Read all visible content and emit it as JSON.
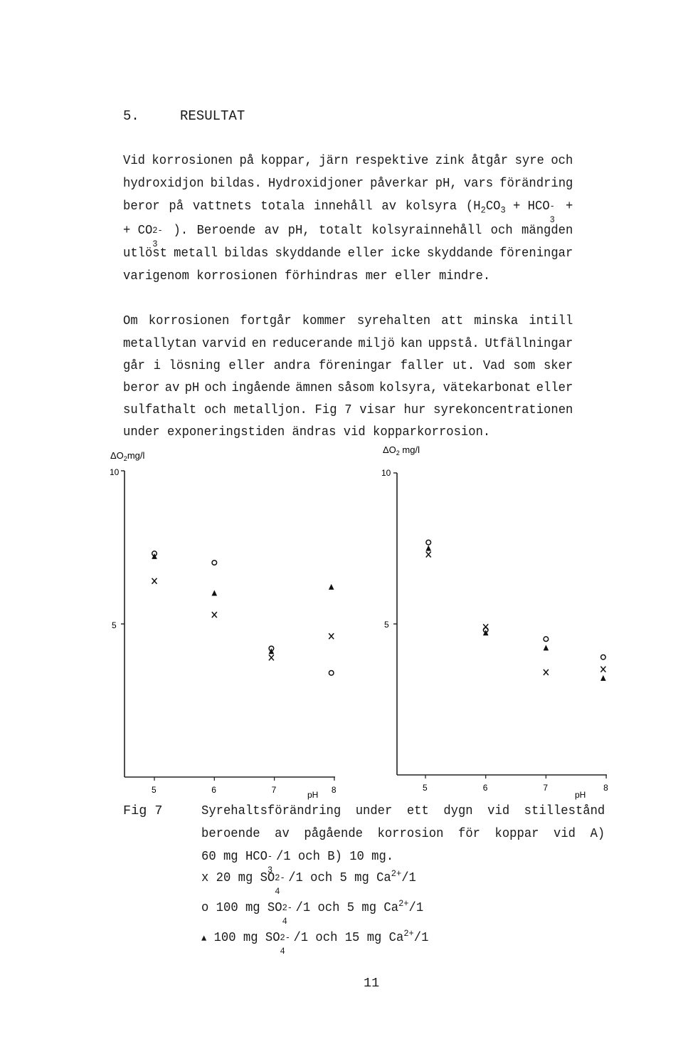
{
  "section": {
    "number": "5.",
    "title": "RESULTAT"
  },
  "paragraph1": {
    "line1": [
      "Vid",
      "korrosionen",
      "på",
      "koppar,",
      "järn",
      "respektive",
      "zink",
      "åtgår",
      "syre",
      "och"
    ],
    "line2": [
      "hydroxidjon",
      "bildas.",
      "Hydroxidjoner",
      "påverkar",
      "pH,",
      "vars",
      "förändring"
    ],
    "line3_words": [
      "beror",
      "på",
      "vattnets",
      "totala",
      "innehåll",
      "av",
      "kolsyra"
    ],
    "line3_formula": {
      "open": "(H",
      "sub1": "2",
      "mid": "CO",
      "sub2": "3",
      "plus": " + HCO",
      "sup3": "-",
      "sub3": "3",
      "end": " +"
    },
    "line4_formula": {
      "start": "+ CO",
      "sup": "2-",
      "sub": "3",
      "end": " )."
    },
    "line4_words": [
      "Beroende",
      "av",
      "pH,",
      "totalt",
      "kolsyrainnehåll",
      "och",
      "mängden"
    ],
    "line5": [
      "utlöst",
      "metall",
      "bildas",
      "skyddande",
      "eller",
      "icke",
      "skyddande",
      "föreningar"
    ],
    "line6": "varigenom korrosionen förhindras mer eller mindre."
  },
  "paragraph2": {
    "line1": [
      "Om",
      "korrosionen",
      "fortgår",
      "kommer",
      "syrehalten",
      "att",
      "minska",
      "intill"
    ],
    "line2": [
      "metallytan",
      "varvid",
      "en",
      "reducerande",
      "miljö",
      "kan",
      "uppstå.",
      "Utfällningar"
    ],
    "line3": [
      "går",
      "i",
      "lösning",
      "eller",
      "andra",
      "föreningar",
      "faller",
      "ut.",
      "Vad",
      "som",
      "sker"
    ],
    "line4": [
      "beror",
      "av",
      "pH",
      "och",
      "ingående",
      "ämnen",
      "såsom",
      "kolsyra,",
      "vätekarbonat",
      "eller"
    ],
    "line5": [
      "sulfathalt",
      "och",
      "metalljon.",
      "Fig",
      "7",
      "visar",
      "hur",
      "syrekoncentrationen"
    ],
    "line6": "under exponeringstiden ändras vid kopparkorrosion."
  },
  "chart_data": [
    {
      "type": "scatter",
      "panel": "A",
      "title": "",
      "ylabel": "ΔO2 mg/l",
      "xlabel": "pH",
      "xlim": [
        4.5,
        8
      ],
      "ylim": [
        0,
        10
      ],
      "xticks": [
        "5",
        "6",
        "7",
        "8"
      ],
      "yticks": [
        "5",
        "10"
      ],
      "grid": false,
      "series": [
        {
          "name": "x",
          "marker": "x",
          "points": [
            [
              5.0,
              6.4
            ],
            [
              6.0,
              5.3
            ],
            [
              6.95,
              3.9
            ],
            [
              7.95,
              4.6
            ]
          ]
        },
        {
          "name": "o",
          "marker": "circle",
          "points": [
            [
              5.0,
              7.3
            ],
            [
              6.0,
              7.0
            ],
            [
              6.95,
              4.2
            ],
            [
              7.95,
              3.4
            ]
          ]
        },
        {
          "name": "▲",
          "marker": "triangle",
          "points": [
            [
              5.0,
              7.2
            ],
            [
              6.0,
              6.0
            ],
            [
              6.95,
              4.1
            ],
            [
              7.95,
              6.2
            ]
          ]
        }
      ]
    },
    {
      "type": "scatter",
      "panel": "B",
      "title": "",
      "ylabel": "ΔO2 mg/l",
      "xlabel": "pH",
      "xlim": [
        4.5,
        8
      ],
      "ylim": [
        0,
        10
      ],
      "xticks": [
        "5",
        "6",
        "7",
        "8"
      ],
      "yticks": [
        "5",
        "10"
      ],
      "grid": false,
      "series": [
        {
          "name": "x",
          "marker": "x",
          "points": [
            [
              5.05,
              7.3
            ],
            [
              6.0,
              4.9
            ],
            [
              7.0,
              3.4
            ],
            [
              7.95,
              3.5
            ]
          ]
        },
        {
          "name": "o",
          "marker": "circle",
          "points": [
            [
              5.05,
              7.7
            ],
            [
              6.0,
              4.8
            ],
            [
              7.0,
              4.5
            ],
            [
              7.95,
              3.9
            ]
          ]
        },
        {
          "name": "▲",
          "marker": "triangle",
          "points": [
            [
              5.05,
              7.5
            ],
            [
              6.0,
              4.7
            ],
            [
              7.0,
              4.2
            ],
            [
              7.95,
              3.2
            ]
          ]
        }
      ]
    }
  ],
  "chart_labels": {
    "left_ylabel_pre": "ΔO",
    "left_ylabel_sub": "2",
    "left_ylabel_post": "mg/l",
    "right_ylabel_pre": "ΔO",
    "right_ylabel_sub": "2",
    "right_ylabel_post": " mg/l",
    "ytick_10": "10",
    "ytick_5": "5",
    "xticks": [
      "5",
      "6",
      "7",
      "8"
    ],
    "xlabel": "pH"
  },
  "caption": {
    "label": "Fig 7",
    "line1": [
      "Syrehaltsförändring",
      "under",
      "ett",
      "dygn",
      "vid",
      "stillestånd"
    ],
    "line2": [
      "beroende",
      "av",
      "pågående",
      "korrosion",
      "för",
      "koppar",
      "vid",
      "A)"
    ],
    "line3": {
      "pre": "60 mg HCO",
      "sup": "-",
      "sub": "3",
      "post": "/1 och B) 10 mg."
    },
    "legend": [
      {
        "marker_icon": "x",
        "text_pre": " 20 mg SO",
        "sup1": "2-",
        "sub1": "4",
        "text_mid": "/1 och 5 mg Ca",
        "sup2": "2+",
        "text_end": "/1"
      },
      {
        "marker_icon": "o",
        "text_pre": "100 mg SO",
        "sup1": "2-",
        "sub1": "4",
        "text_mid": "/1 och 5 mg Ca",
        "sup2": "2+",
        "text_end": "/1"
      },
      {
        "marker_icon": "▲",
        "text_pre": "100 mg SO",
        "sup1": "2-",
        "sub1": "4",
        "text_mid": "/1 och 15 mg Ca",
        "sup2": "2+",
        "text_end": "/1"
      }
    ]
  },
  "page_number": "11"
}
